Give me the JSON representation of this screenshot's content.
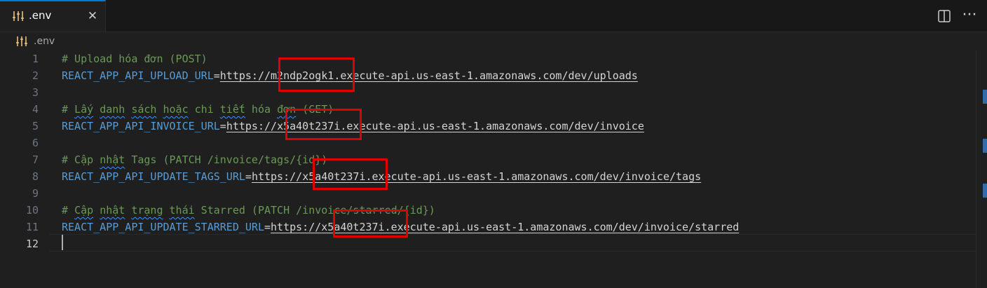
{
  "tab": {
    "label": ".env",
    "close_symbol": "✕"
  },
  "toolbar": {
    "more_symbol": "···"
  },
  "breadcrumb": {
    "label": ".env"
  },
  "editor": {
    "lines": [
      {
        "n": "1",
        "comment": "# Upload hóa đơn (POST)"
      },
      {
        "n": "2",
        "key": "REACT_APP_API_UPLOAD_URL",
        "eq": "=",
        "scheme": "https://",
        "host": "m2ndp2ogk1",
        "rest": ".execute-api.us-east-1.amazonaws.com/dev/uploads"
      },
      {
        "n": "3"
      },
      {
        "n": "4",
        "c1": "# ",
        "c2": "Lấy",
        "c3": " ",
        "c4": "danh",
        "c5": " ",
        "c6": "sách",
        "c7": " ",
        "c8": "hoặc",
        "c9": " chi ",
        "c10": "tiết",
        "c11": " hóa ",
        "c12": "đơn",
        "c13": " (GET)"
      },
      {
        "n": "5",
        "key": "REACT_APP_API_INVOICE_URL",
        "eq": "=",
        "scheme": "https://",
        "host": "x5a40t237i",
        "rest": ".execute-api.us-east-1.amazonaws.com/dev/invoice"
      },
      {
        "n": "6"
      },
      {
        "n": "7",
        "c1": "# Cập ",
        "c2": "nhật",
        "c3": " Tags (PATCH /invoice/tags/{id})"
      },
      {
        "n": "8",
        "key": "REACT_APP_API_UPDATE_TAGS_URL",
        "eq": "=",
        "scheme": "https://",
        "host": "x5a40t237i",
        "rest": ".execute-api.us-east-1.amazonaws.com/dev/invoice/tags"
      },
      {
        "n": "9"
      },
      {
        "n": "10",
        "c1": "# ",
        "c2": "Cập",
        "c3": " ",
        "c4": "nhật",
        "c5": " ",
        "c6": "trạng",
        "c7": " ",
        "c8": "thái",
        "c9": " Starred (PATCH /invoice/starred/{id})"
      },
      {
        "n": "11",
        "key": "REACT_APP_API_UPDATE_STARRED_URL",
        "eq": "=",
        "scheme": "https://",
        "host": "x5a40t237i",
        "rest": ".execute-api.us-east-1.amazonaws.com/dev/invoice/starred"
      },
      {
        "n": "12"
      }
    ]
  },
  "colors": {
    "comment": "#6a9955",
    "key": "#569cd6",
    "highlight_box": "#e00000",
    "accent": "#0078d4"
  },
  "icons": {
    "tab": "settings-sliders-icon",
    "split": "split-editor-icon",
    "more": "more-actions-icon"
  }
}
